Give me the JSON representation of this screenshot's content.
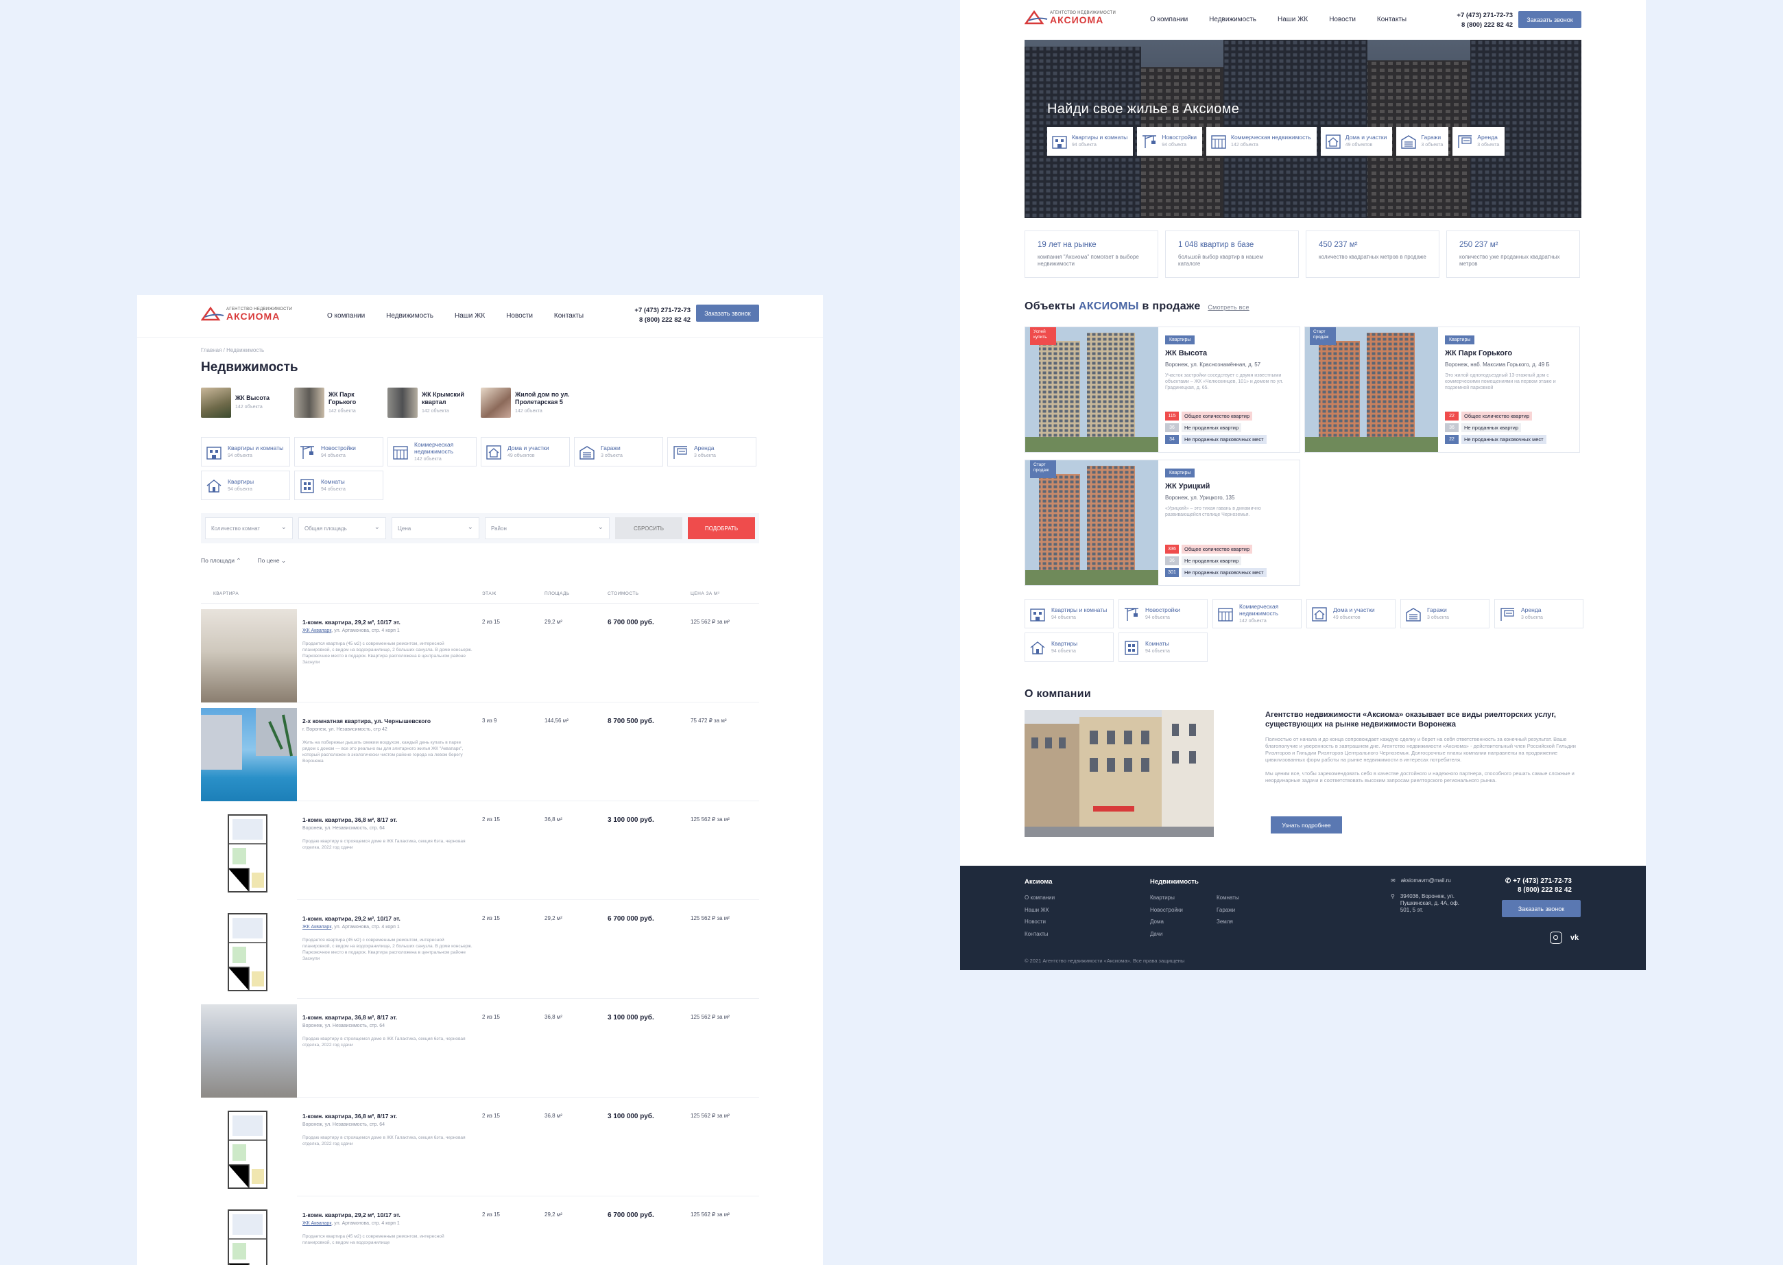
{
  "brand": {
    "subtitle": "АГЕНТСТВО НЕДВИЖИМОСТИ",
    "name": "АКСИОМА",
    "colors": {
      "accent": "#5a78b2",
      "red": "#ef4c4c",
      "dark": "#1f2a3c"
    }
  },
  "nav": [
    "О компании",
    "Недвижимость",
    "Наши ЖК",
    "Новости",
    "Контакты"
  ],
  "phones": [
    "+7 (473) 271-72-73",
    "8 (800) 222 82 42"
  ],
  "cta": "Заказать звонок",
  "listing": {
    "breadcrumbs": "Главная  /  Недвижимость",
    "title": "Недвижимость",
    "complexes": [
      {
        "name": "ЖК Высота",
        "count": "142 объекта"
      },
      {
        "name": "ЖК Парк Горького",
        "count": "142 объекта"
      },
      {
        "name": "ЖК Крымский квартал",
        "count": "142 объекта"
      },
      {
        "name": "Жилой дом по ул. Пролетарская 5",
        "count": "142 объекта"
      }
    ],
    "filters": {
      "rooms": "Количество комнат",
      "area": "Общая площадь",
      "price": "Цена",
      "district": "Район",
      "reset": "СБРОСИТЬ",
      "submit": "ПОДОБРАТЬ"
    },
    "sorts": [
      "По площади",
      "По цене"
    ],
    "columns": [
      "КВАРТИРА",
      "ЭТАЖ",
      "ПЛОЩАДЬ",
      "СТОИМОСТЬ",
      "ЦЕНА ЗА М²"
    ],
    "rows": [
      {
        "title": "1-комн. квартира, 29,2 м², 10/17 эт.",
        "link": "ЖК Аквапарк",
        "addr": ", ул. Артамонова, стр. 4 корп 1",
        "desc": "Продается квартира (45 м2) с современным ремонтом, интересной планировкой, с видом на водохранилище, 2 больших санузла. В доме консьерж. Парковочное место в подарок. Квартира расположена в центральном районе Заснули",
        "floor": "2 из 15",
        "area": "29,2 м²",
        "price": "6 700 000 руб.",
        "ppm": "125 562 ₽ за м²",
        "img": "interior"
      },
      {
        "title": "2-х комнатная квартира, ул. Чернышевского",
        "link": "",
        "addr": "г. Воронеж, ул. Независимость, стр 42",
        "desc": "Жить на побережьи дышать свежим воздухом, каждый день купать в парке рядом с домом — все это реально вы для элитарного жилья ЖК \"Аквапарк\", который расположен в экологически чистом районе города на левом берегу Воронежа",
        "floor": "3 из 9",
        "area": "144,56 м²",
        "price": "8 700 500 руб.",
        "ppm": "75 472 ₽ за м²",
        "img": "pool"
      },
      {
        "title": "1-комн. квартира, 36,8 м², 8/17 эт.",
        "link": "",
        "addr": "Воронеж, ул. Независимость, стр. 64",
        "desc": "Продаю квартиру в строящемся доме в ЖК Галактика, секция 6эта, черновая отделка, 2022 год сдачи",
        "floor": "2 из 15",
        "area": "36,8 м²",
        "price": "3 100 000 руб.",
        "ppm": "125 562 ₽ за м²",
        "img": "plan"
      },
      {
        "title": "1-комн. квартира, 29,2 м², 10/17 эт.",
        "link": "ЖК Аквапарк",
        "addr": ", ул. Артамонова, стр. 4 корп 1",
        "desc": "Продается квартира (45 м2) с современным ремонтом, интересной планировкой, с видом на водохранилище, 2 больших санузла. В доме консьерж. Парковочное место в подарок. Квартира расположена в центральном районе Заснули",
        "floor": "2 из 15",
        "area": "29,2 м²",
        "price": "6 700 000 руб.",
        "ppm": "125 562 ₽ за м²",
        "img": "plan"
      },
      {
        "title": "1-комн. квартира, 36,8 м², 8/17 эт.",
        "link": "",
        "addr": "Воронеж, ул. Независимость, стр. 64",
        "desc": "Продаю квартиру в строящемся доме в ЖК Галактика, секция 6эта, черновая отделка, 2022 год сдачи",
        "floor": "2 из 15",
        "area": "36,8 м²",
        "price": "3 100 000 руб.",
        "ppm": "125 562 ₽ за м²",
        "img": "empty"
      },
      {
        "title": "1-комн. квартира, 36,8 м², 8/17 эт.",
        "link": "",
        "addr": "Воронеж, ул. Независимость, стр. 64",
        "desc": "Продаю квартиру в строящемся доме в ЖК Галактика, секция 6эта, черновая отделка, 2022 год сдачи",
        "floor": "2 из 15",
        "area": "36,8 м²",
        "price": "3 100 000 руб.",
        "ppm": "125 562 ₽ за м²",
        "img": "plan"
      },
      {
        "title": "1-комн. квартира, 29,2 м², 10/17 эт.",
        "link": "ЖК Аквапарк",
        "addr": ", ул. Артамонова, стр. 4 корп 1",
        "desc": "Продается квартира (45 м2) с современным ремонтом, интересной планировкой, с видом на водохранилище",
        "floor": "2 из 15",
        "area": "29,2 м²",
        "price": "6 700 000 руб.",
        "ppm": "125 562 ₽ за м²",
        "img": "plan"
      }
    ]
  },
  "categories": [
    {
      "name": "Квартиры и комнаты",
      "count": "94 объекта",
      "icon": "apartment-icon"
    },
    {
      "name": "Новостройки",
      "count": "94 объекта",
      "icon": "crane-icon"
    },
    {
      "name": "Коммерческая недвижимость",
      "count": "142 объекта",
      "icon": "office-icon"
    },
    {
      "name": "Дома и участки",
      "count": "49 объектов",
      "icon": "house-plot-icon"
    },
    {
      "name": "Гаражи",
      "count": "3 объекта",
      "icon": "garage-icon"
    },
    {
      "name": "Аренда",
      "count": "3 объекта",
      "icon": "rent-sign-icon"
    },
    {
      "name": "Квартиры",
      "count": "94 объекта",
      "icon": "home-icon"
    },
    {
      "name": "Комнаты",
      "count": "94 объекта",
      "icon": "room-icon"
    }
  ],
  "home": {
    "hero": "Найди свое жилье в Аксиоме",
    "stats": [
      {
        "value": "19 лет на рынке",
        "desc": "компания \"Аксиома\" помогает в выборе недвижимости"
      },
      {
        "value": "1 048 квартир в базе",
        "desc": "большой выбор квартир в нашем каталоге"
      },
      {
        "value": "450 237 м²",
        "desc": "количество квадратных метров в продаже"
      },
      {
        "value": "250 237 м²",
        "desc": "количество уже проданных квадратных метров"
      }
    ],
    "objects_title_a": "Объекты",
    "objects_title_b": "АКСИОМЫ",
    "objects_title_c": "в продаже",
    "see_all": "Смотреть все",
    "complexes": [
      {
        "badge": "Успей купить",
        "badge_color": "#ef4c4c",
        "tag": "Квартиры",
        "name": "ЖК Высота",
        "addr": "Воронеж, ул. Красноз­намённая, д. 57",
        "desc": "Участок застройки соседствует с двумя известными объектами – ЖК «Челюскинцев, 101» и домом по ул. Градинецкая, д. 65.",
        "total": "115",
        "unsold": "36",
        "parking": "34"
      },
      {
        "badge": "Старт продаж",
        "badge_color": "#5a78b2",
        "tag": "Квартиры",
        "name": "ЖК Парк Горького",
        "addr": "Воронеж, наб. Максима Горького, д. 49 Б",
        "desc": "Это жилой однопод­ъездный 13-этажный дом с коммерческими помещениями на первом этаже и подземной парковкой",
        "total": "22",
        "unsold": "36",
        "parking": "22"
      },
      {
        "badge": "Старт продаж",
        "badge_color": "#5a78b2",
        "tag": "Квартиры",
        "name": "ЖК Урицкий",
        "addr": "Воронеж, ул. Урицкого, 135",
        "desc": "«Урицкий» – это тихая гавань в динамично развивающейся столице Черноземья.",
        "total": "336",
        "unsold": "36",
        "parking": "301"
      }
    ],
    "count_labels": {
      "total": "Общее количество квартир",
      "unsold": "Не проданных квартир",
      "parking": "Не проданных парковочных мест"
    },
    "about": {
      "title": "О компании",
      "heading": "Агентство недвижимости «Аксиома» оказывает все виды риелторских услуг, существующих на рынке недвижимости Воронежа",
      "p1": "Полностью от начала и до конца сопровождает каждую сделку и берет на себя ответственность за конечный результат. Ваше благополучие и уверенность в завтрашнем дне. Агентство недвижимости «Аксиома» - действительный член Российской Гильдии Риэлторов и Гильдии Риэлторов Центрального Черноземья. Долгосрочные планы компании направлены на продвижение цивилизованных форм работы на рынке недвижимости в интересах потребителя.",
      "p2": "Мы ценим все, чтобы зарекомендовать себя в качестве достойного и надежного партнера, способного решать самые сложные и неординарные задачи и соответствовать высоким запросам риелторского регионального рынка.",
      "more": "Узнать подробнее"
    },
    "footer": {
      "col1_title": "Аксиома",
      "col1": [
        "О компании",
        "Наши ЖК",
        "Новости",
        "Контакты"
      ],
      "col2_title": "Недвижимость",
      "col2a": [
        "Квартиры",
        "Новостройки",
        "Дома",
        "Дачи"
      ],
      "col2b": [
        "Комнаты",
        "Гаражи",
        "Земля"
      ],
      "email": "aksiomavrn@mail.ru",
      "address": "394036, Воронеж, ул. Пушкинская, д. 4А, оф. 501, 5 эт.",
      "copy": "© 2021 Агентство недвижимости «Аксиома». Все права защищены"
    }
  }
}
